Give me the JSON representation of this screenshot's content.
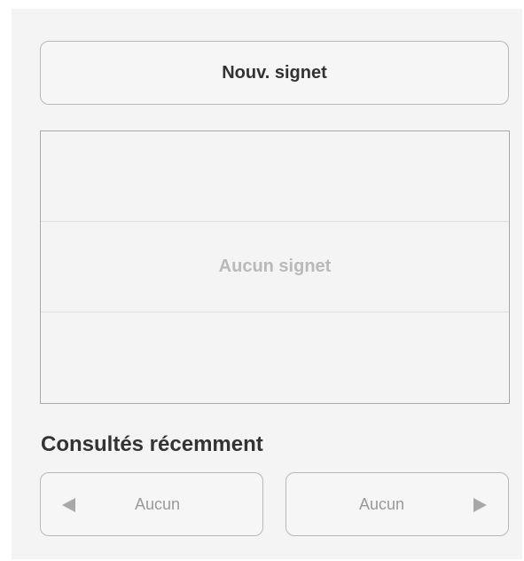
{
  "new_bookmark": {
    "label": "Nouv. signet"
  },
  "bookmarks": {
    "empty_label": "Aucun signet"
  },
  "recent": {
    "title": "Consultés récemment",
    "prev": {
      "label": "Aucun",
      "icon": "left-triangle-icon"
    },
    "next": {
      "label": "Aucun",
      "icon": "right-triangle-icon"
    }
  },
  "colors": {
    "panel_bg": "#f4f4f4",
    "border": "#b8b8b8",
    "text_dark": "#333333",
    "text_muted": "#b9b9b9"
  }
}
